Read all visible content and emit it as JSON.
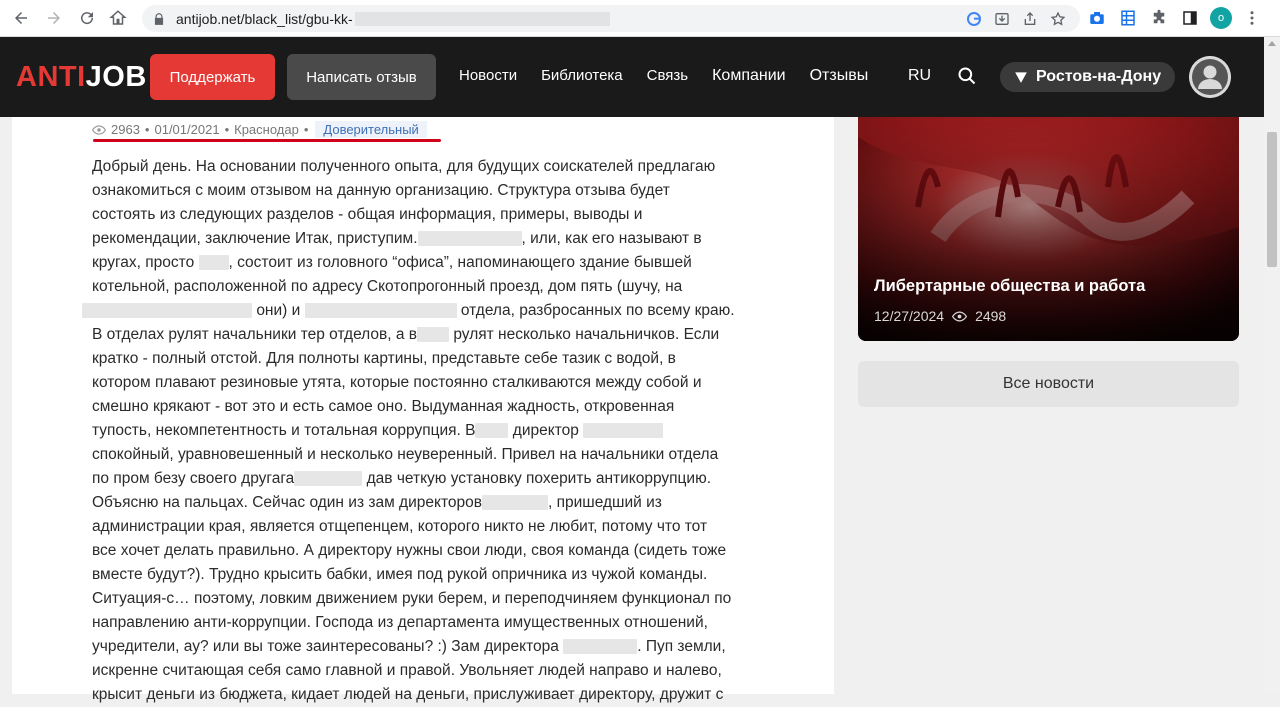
{
  "browser": {
    "url_text": "antijob.net/black_list/gbu-kk-",
    "profile_initial": "o"
  },
  "header": {
    "logo_part1": "ANTI",
    "logo_part2": "JOB",
    "support_btn": "Поддержать",
    "review_btn": "Написать отзыв",
    "menu": [
      "Новости",
      "Библиотека",
      "Связь",
      "Компании",
      "Отзывы"
    ],
    "lang": "RU",
    "city": "Ростов-на-Дону"
  },
  "article": {
    "views": "2963",
    "date": "01/01/2021",
    "city": "Краснодар",
    "badge": "Доверительный",
    "lines": [
      "Добрый день. На основании полученного опыта, для будущих соискателей предлагаю",
      "ознакомиться с моим отзывом на данную организацию. Структура отзыва будет",
      "состоять из следующих разделов - общая информация, примеры, выводы и",
      "рекомендации, заключение Итак, приступим.",
      ", или, как его называют в",
      "кругах, просто",
      ", состоит из головного “офиса”, напоминающего здание бывшей",
      "котельной, расположенной по адресу Скотопрогонный проезд, дом пять (шучу, на",
      "они) и",
      "отдела, разбросанных по всему краю.",
      "В отделах рулят начальники тер отделов, а в",
      "рулят несколько начальничков. Если",
      "кратко - полный отстой. Для полноты картины, представьте себе тазик с водой, в",
      "котором плавают резиновые утята, которые постоянно сталкиваются между собой и",
      "смешно крякают - вот это и есть самое оно. Выдуманная жадность, откровенная",
      "тупость, некомпетентность и тотальная коррупция. В",
      "директор",
      "спокойный, уравновешенный и несколько неуверенный. Привел на начальники отдела",
      "по пром безу своего другага",
      "дав четкую установку похерить антикоррупцию.",
      "Объясню на пальцах. Сейчас один из зам директоров",
      ", пришедший из",
      "администрации края, является отщепенцем, которого никто не любит, потому что тот",
      "все хочет делать правильно. А директору нужны свои люди, своя команда (сидеть тоже",
      "вместе будут?). Трудно крысить бабки, имея под рукой опричника из чужой команды.",
      "Ситуация-с… поэтому, ловким движением руки берем, и переподчиняем функционал по",
      "направлению анти-коррупции. Господа из департамента имущественных отношений,",
      "учредители, ау? или вы тоже заинтересованы? :) Зам директора",
      ". Пуп земли,",
      "искренне считающая себя само главной и правой. Увольняет людей направо и налево,",
      "крысит деньги из бюджета, кидает людей на деньги, прислуживает директору, дружит с"
    ]
  },
  "sidebar": {
    "news_title": "Либертарные общества и работа",
    "news_date": "12/27/2024",
    "news_views": "2498",
    "all_news": "Все новости"
  },
  "colors": {
    "brand_red": "#e53935",
    "header_bg": "#1a1a1a",
    "badge_text": "#3e6fb7"
  }
}
